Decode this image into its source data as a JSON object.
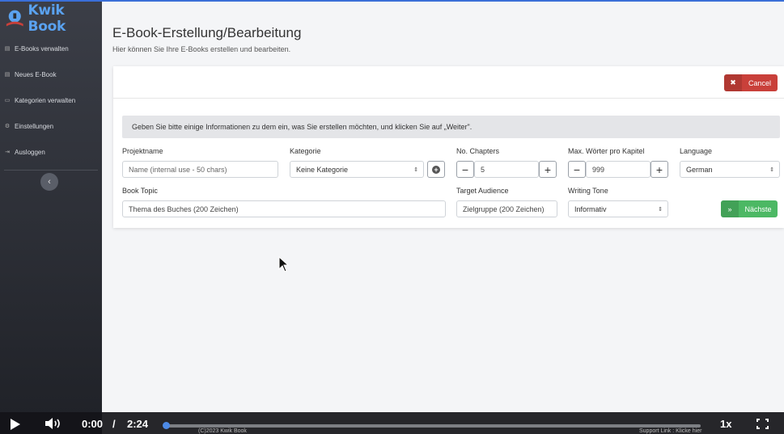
{
  "brand": {
    "name": "Kwik Book"
  },
  "sidebar": {
    "items": [
      {
        "label": "E-Books verwalten",
        "icon": "file-icon"
      },
      {
        "label": "Neues E-Book",
        "icon": "document-icon"
      },
      {
        "label": "Kategorien verwalten",
        "icon": "folder-icon"
      },
      {
        "label": "Einstellungen",
        "icon": "gear-icon"
      },
      {
        "label": "Ausloggen",
        "icon": "logout-icon"
      }
    ],
    "collapse_glyph": "‹"
  },
  "page": {
    "title": "E-Book-Erstellung/Bearbeitung",
    "subtitle": "Hier können Sie Ihre E-Books erstellen und bearbeiten."
  },
  "card": {
    "cancel_label": "Cancel",
    "info_text": "Geben Sie bitte einige Informationen zu dem ein, was Sie erstellen möchten, und klicken Sie auf „Weiter\".",
    "fields": {
      "projektname": {
        "label": "Projektname",
        "placeholder": "Name (internal use - 50 chars)"
      },
      "kategorie": {
        "label": "Kategorie",
        "value": "Keine Kategorie"
      },
      "chapters": {
        "label": "No. Chapters",
        "value": "5"
      },
      "max_words": {
        "label": "Max. Wörter pro Kapitel",
        "value": "999"
      },
      "language": {
        "label": "Language",
        "value": "German"
      },
      "book_topic": {
        "label": "Book Topic",
        "placeholder": "Thema des Buches (200 Zeichen)"
      },
      "target_audience": {
        "label": "Target Audience",
        "placeholder": "Zielgruppe (200 Zeichen)"
      },
      "writing_tone": {
        "label": "Writing Tone",
        "value": "Informativ"
      }
    },
    "next_label": "Nächste"
  },
  "video": {
    "current_time": "0:00",
    "separator": "/",
    "duration": "2:24",
    "progress": 0.0,
    "speed": "1x",
    "footer_left": "(C)2023 Kwik Book",
    "footer_right": "Support Link : Klicke hier"
  },
  "colors": {
    "accent": "#3a6fd8",
    "cancel": "#c9403a",
    "next": "#4cb864",
    "brand": "#5aa2f0"
  }
}
